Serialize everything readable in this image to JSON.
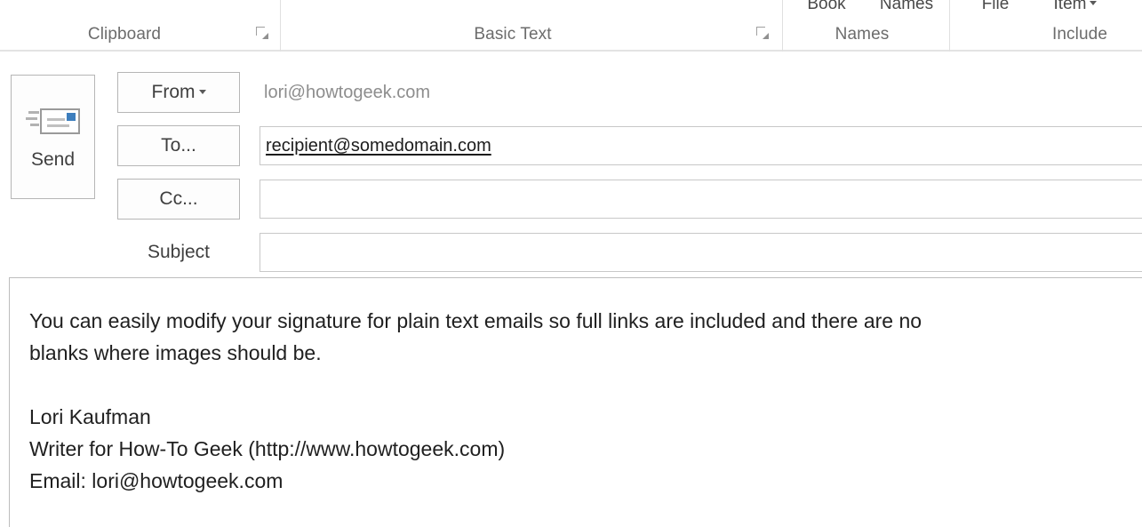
{
  "ribbon": {
    "clipped_commands": [
      {
        "label": "Book"
      },
      {
        "label": "Names"
      },
      {
        "label": "File"
      },
      {
        "label": "Item",
        "caret": true
      }
    ],
    "groups": [
      {
        "label": "Clipboard",
        "has_launcher": true
      },
      {
        "label": "Basic Text",
        "has_launcher": true
      },
      {
        "label": "Names",
        "has_launcher": false
      },
      {
        "label": "Include",
        "has_launcher": false
      }
    ],
    "launcher_icon": "dialog-box-launcher-icon"
  },
  "send": {
    "label": "Send",
    "icon": "send-envelope-icon"
  },
  "header_fields": {
    "from": {
      "button_label": "From",
      "caret_icon": "chevron-down-icon",
      "value": "lori@howtogeek.com"
    },
    "to": {
      "button_label": "To...",
      "value": "recipient@somedomain.com",
      "placeholder": ""
    },
    "cc": {
      "button_label": "Cc...",
      "value": "",
      "placeholder": ""
    },
    "subject": {
      "label": "Subject",
      "value": "",
      "placeholder": ""
    }
  },
  "body": {
    "paragraph_line_1": "You can easily modify your signature for plain text emails so full links are included and there are no",
    "paragraph_line_2": "blanks where images should be.",
    "signature_line_1": "Lori Kaufman",
    "signature_line_2": "Writer for How-To Geek (http://www.howtogeek.com)",
    "signature_line_3": "Email: lori@howtogeek.com"
  },
  "colors": {
    "accent_stamp": "#3d7ebd",
    "border_gray": "#b6b6b6",
    "input_border": "#c8c8c8",
    "muted_text": "#8d8d8d",
    "body_text": "#202020"
  }
}
